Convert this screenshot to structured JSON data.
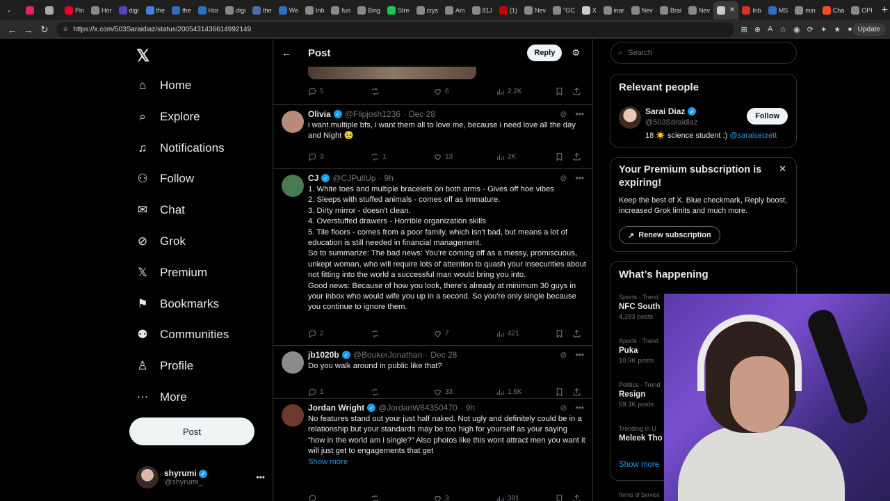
{
  "browser": {
    "tabs": [
      {
        "label": "",
        "color": "#e0245e"
      },
      {
        "label": "",
        "color": "#aaaaaa"
      },
      {
        "label": "Pin",
        "color": "#e60023"
      },
      {
        "label": "Hor",
        "color": "#888888"
      },
      {
        "label": "digi",
        "color": "#5a3fbf"
      },
      {
        "label": "the",
        "color": "#3d7fd9"
      },
      {
        "label": "the",
        "color": "#2f6ec2"
      },
      {
        "label": "Hor",
        "color": "#2f6ec2"
      },
      {
        "label": "digi",
        "color": "#888888"
      },
      {
        "label": "the",
        "color": "#4a6fa5"
      },
      {
        "label": "We",
        "color": "#2f6ec2"
      },
      {
        "label": "Inb",
        "color": "#888888"
      },
      {
        "label": "fun",
        "color": "#888888"
      },
      {
        "label": "Bing",
        "color": "#888888"
      },
      {
        "label": "Stre",
        "color": "#23c552"
      },
      {
        "label": "crys",
        "color": "#888888"
      },
      {
        "label": "Am",
        "color": "#888888"
      },
      {
        "label": "81J",
        "color": "#888888"
      },
      {
        "label": "(1)",
        "color": "#cc0000"
      },
      {
        "label": "Nev",
        "color": "#888888"
      },
      {
        "label": "\"GC",
        "color": "#888888"
      },
      {
        "label": "X",
        "color": "#cccccc"
      },
      {
        "label": "inar",
        "color": "#888888"
      },
      {
        "label": "Nev",
        "color": "#888888"
      },
      {
        "label": "Brai",
        "color": "#888888"
      },
      {
        "label": "Nev",
        "color": "#888888"
      },
      {
        "label": "",
        "color": "#cccccc"
      },
      {
        "label": "Inb",
        "color": "#d93025"
      },
      {
        "label": "MS",
        "color": "#2f6ec2"
      },
      {
        "label": "min",
        "color": "#888888"
      },
      {
        "label": "Cha",
        "color": "#f25022"
      },
      {
        "label": "OPI",
        "color": "#888888"
      }
    ],
    "url": "https://x.com/503Saraidiaz/status/2005431436614992149",
    "update_label": "Update"
  },
  "nav": {
    "items": [
      {
        "label": "Home",
        "icon": "home-icon"
      },
      {
        "label": "Explore",
        "icon": "search-icon"
      },
      {
        "label": "Notifications",
        "icon": "bell-icon"
      },
      {
        "label": "Follow",
        "icon": "follow-icon"
      },
      {
        "label": "Chat",
        "icon": "mail-icon"
      },
      {
        "label": "Grok",
        "icon": "grok-icon"
      },
      {
        "label": "Premium",
        "icon": "x-icon"
      },
      {
        "label": "Bookmarks",
        "icon": "bookmark-icon"
      },
      {
        "label": "Communities",
        "icon": "communities-icon"
      },
      {
        "label": "Profile",
        "icon": "person-icon"
      },
      {
        "label": "More",
        "icon": "more-circle-icon"
      }
    ],
    "post_label": "Post",
    "account": {
      "name": "shyrumi",
      "handle": "@shyrumi_"
    }
  },
  "center": {
    "title": "Post",
    "reply_label": "Reply",
    "top_actions": {
      "replies": "5",
      "reposts": "",
      "likes": "6",
      "views": "2.2K"
    },
    "tweets": [
      {
        "name": "Olivia",
        "handle": "@Flipjosh1236",
        "time": "Dec 28",
        "text": "i want multiple bfs, i want them all to love me, because i need love all the day and Night 🥺",
        "replies": "3",
        "reposts": "1",
        "likes": "13",
        "views": "2K",
        "avatar": "#b98a7a"
      },
      {
        "name": "CJ",
        "handle": "@CJPullUp",
        "time": "9h",
        "lines": [
          "1. White toes and multiple bracelets on both arms - Gives off hoe vibes",
          "2. Sleeps with stuffed animals - comes off as immature.",
          "3. Dirty mirror - doesn't clean.",
          "4. Overstuffed drawers - Horrible organization skills",
          "5. Tile floors - comes from a poor family, which isn't bad, but means a lot of education is still needed in financial management.",
          "So to summarize: The bad news: You're coming off as a messy, promiscuous, unkept woman, who will require lots of attention to quash your insecurities about not fitting into the world a successful man would bring you into.",
          "Good news: Because of how you look, there's already at minimum 30 guys in your inbox who would wife you up in a second. So you're only single because you continue to ignore them."
        ],
        "replies": "2",
        "reposts": "",
        "likes": "7",
        "views": "421",
        "avatar": "#4a7a4f"
      },
      {
        "name": "jb1020b",
        "handle": "@BoukerJonathan",
        "time": "Dec 28",
        "text": "Do you walk around in public like that?",
        "replies": "1",
        "reposts": "",
        "likes": "33",
        "views": "1.6K",
        "avatar": "#8a8a8a"
      },
      {
        "name": "Jordan Wright",
        "handle": "@JordanW64350470",
        "time": "9h",
        "text": "No features stand out your just half naked. Not ugly and definitely could be in a relationship but your standards may be too high for yourself as your saying “how in the world am i single?” Also photos like this wont attract men you want it will just get to engagements that get",
        "show_more": "Show more",
        "replies": "",
        "reposts": "",
        "likes": "3",
        "views": "391",
        "avatar": "#6b3b2e"
      }
    ]
  },
  "right": {
    "search_placeholder": "Search",
    "relevant": {
      "title": "Relevant people",
      "name": "Sarai Diaz",
      "handle": "@503Saraidiaz",
      "bio": "18 ☀️ science student :)",
      "bio_link": "@saraisecrett",
      "follow_label": "Follow"
    },
    "premium": {
      "title": "Your Premium subscription is expiring!",
      "text": "Keep the best of X. Blue checkmark, Reply boost, increased Grok limits and much more.",
      "button": "Renew subscription"
    },
    "happening": {
      "title": "What’s happening",
      "trends": [
        {
          "category": "Sports · Trend",
          "name": "NFC South",
          "posts": "4,283 posts"
        },
        {
          "category": "Sports · Trend",
          "name": "Puka",
          "posts": "10.9K posts"
        },
        {
          "category": "Politics · Trend",
          "name": "Resign",
          "posts": "59.3K posts"
        },
        {
          "category": "Trending in U",
          "name": "Meleek Tho",
          "posts": ""
        }
      ],
      "show_more": "Show more"
    },
    "terms": "Terms of Service"
  }
}
